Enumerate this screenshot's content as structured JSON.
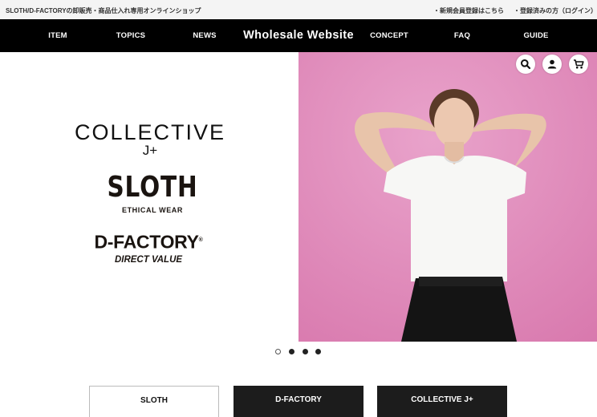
{
  "topbar": {
    "site_description": "SLOTH/D-FACTORYの卸販売・商品仕入れ専用オンラインショップ",
    "register_link": "・新規会員登録はこちら",
    "login_link": "・登録済みの方（ログイン）"
  },
  "nav": {
    "items": [
      "ITEM",
      "TOPICS",
      "NEWS",
      "CONCEPT",
      "FAQ",
      "GUIDE"
    ],
    "brand_title": "Wholesale Website"
  },
  "hero": {
    "logo_collective": "COLLECTIVE",
    "logo_collective_sub": "J+",
    "logo_sloth": "SLOTH",
    "logo_sloth_sub": "ETHICAL WEAR",
    "logo_dfactory": "D-FACTORY",
    "logo_dfactory_reg": "®",
    "logo_dfactory_sub": "DIRECT VALUE",
    "image_background_color": "#e290bd"
  },
  "header_icons": [
    "search-icon",
    "user-icon",
    "cart-icon"
  ],
  "carousel": {
    "slide_count": 4,
    "active_index": 0
  },
  "brand_tabs": {
    "items": [
      "SLOTH",
      "D-FACTORY",
      "COLLECTIVE J+"
    ],
    "selected": 0
  },
  "colors": {
    "nav_background": "#000000",
    "topbar_background": "#f4f4f4",
    "tab_dark": "#1c1c1c"
  }
}
